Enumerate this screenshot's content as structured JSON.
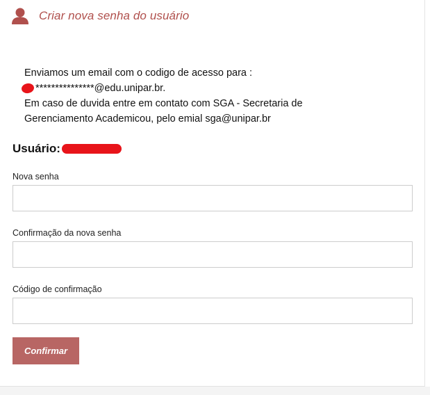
{
  "header": {
    "title": "Criar nova senha do usuário",
    "icon": "user-icon",
    "accent_color": "#b0504d"
  },
  "message": {
    "line1": "Enviamos um email com o codigo de acesso para :",
    "email_masked": "***************@edu.unipar.br.",
    "line3": "Em caso de duvida entre em contato com SGA - Secretaria de",
    "line4": "Gerenciamento Academicou, pelo emial sga@unipar.br"
  },
  "user": {
    "label": "Usuário:"
  },
  "form": {
    "new_password": {
      "label": "Nova senha",
      "value": ""
    },
    "confirm_password": {
      "label": "Confirmação da nova senha",
      "value": ""
    },
    "confirmation_code": {
      "label": "Código de confirmação",
      "value": ""
    }
  },
  "actions": {
    "confirm_label": "Confirmar",
    "button_color": "#b86664"
  }
}
